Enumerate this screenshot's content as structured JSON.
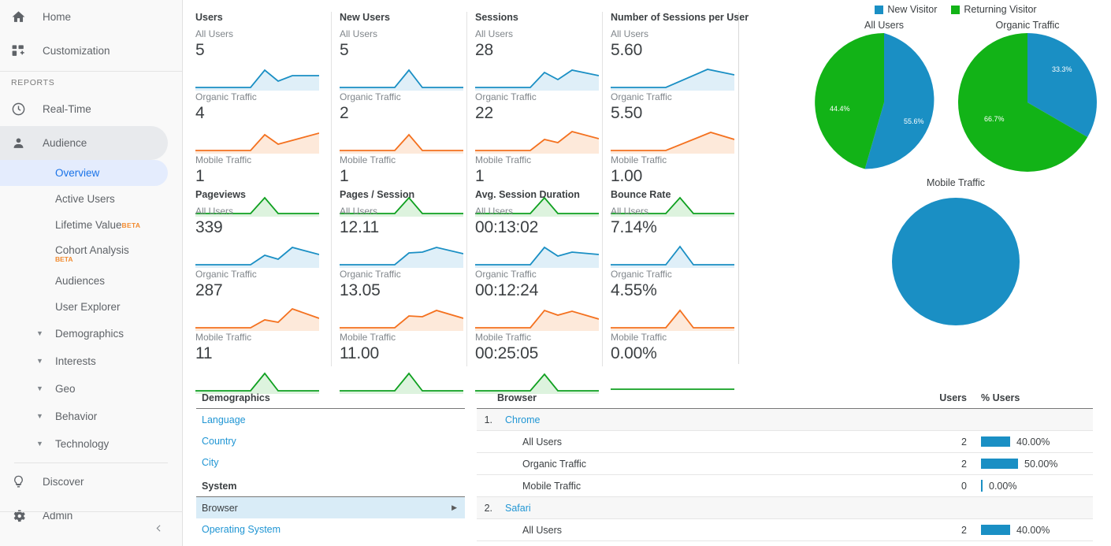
{
  "sidebar": {
    "top_items": [
      {
        "label": "Home",
        "icon": "home-icon"
      },
      {
        "label": "Customization",
        "icon": "customization-icon"
      }
    ],
    "section_label": "REPORTS",
    "reports": [
      {
        "label": "Real-Time",
        "icon": "clock-icon"
      },
      {
        "label": "Audience",
        "icon": "person-icon",
        "state": "expanded"
      }
    ],
    "audience_sub": [
      {
        "label": "Overview",
        "state": "active"
      },
      {
        "label": "Active Users"
      },
      {
        "label": "Lifetime Value",
        "badge": "BETA",
        "badge_pos": "super"
      },
      {
        "label": "Cohort Analysis",
        "badge": "BETA",
        "badge_pos": "below"
      },
      {
        "label": "Audiences"
      },
      {
        "label": "User Explorer"
      },
      {
        "label": "Demographics",
        "caret": "▼"
      },
      {
        "label": "Interests",
        "caret": "▼"
      },
      {
        "label": "Geo",
        "caret": "▼"
      },
      {
        "label": "Behavior",
        "caret": "▼"
      },
      {
        "label": "Technology",
        "caret": "▼"
      }
    ],
    "bottom_items": [
      {
        "label": "Discover",
        "icon": "lightbulb-icon"
      },
      {
        "label": "Admin",
        "icon": "gear-icon"
      }
    ],
    "collapse_icon": "chevron-left-icon"
  },
  "segments": [
    "All Users",
    "Organic Traffic",
    "Mobile Traffic"
  ],
  "cards": [
    {
      "title": "Users",
      "values": [
        "5",
        "4",
        "1"
      ]
    },
    {
      "title": "New Users",
      "values": [
        "5",
        "2",
        "1"
      ]
    },
    {
      "title": "Sessions",
      "values": [
        "28",
        "22",
        "1"
      ]
    },
    {
      "title": "Number of Sessions per User",
      "values": [
        "5.60",
        "5.50",
        "1.00"
      ]
    },
    {
      "title": "Pageviews",
      "values": [
        "339",
        "287",
        "11"
      ]
    },
    {
      "title": "Pages / Session",
      "values": [
        "12.11",
        "13.05",
        "11.00"
      ]
    },
    {
      "title": "Avg. Session Duration",
      "values": [
        "00:13:02",
        "00:12:24",
        "00:25:05"
      ]
    },
    {
      "title": "Bounce Rate",
      "values": [
        "7.14%",
        "4.55%",
        "0.00%"
      ]
    }
  ],
  "colors": {
    "all_users": "#1a8fc4",
    "organic": "#f4711f",
    "mobile": "#0fa020",
    "new_visitor": "#1a8fc4",
    "returning_visitor": "#12b317",
    "link": "#2196d4",
    "accent": "#1a73e8"
  },
  "pies": {
    "legend": [
      {
        "label": "New Visitor",
        "color": "#1a8fc4"
      },
      {
        "label": "Returning Visitor",
        "color": "#12b317"
      }
    ],
    "charts": [
      {
        "title": "All Users",
        "new_pct": "55.6%",
        "ret_pct": "44.4%"
      },
      {
        "title": "Organic Traffic",
        "new_pct": "33.3%",
        "ret_pct": "66.7%"
      },
      {
        "title": "Mobile Traffic",
        "new_pct": "100%",
        "ret_pct": null
      }
    ]
  },
  "demographics_panel": {
    "header": "Demographics",
    "items": [
      "Language",
      "Country",
      "City"
    ],
    "system_header": "System",
    "system_items": [
      {
        "label": "Browser",
        "selected": true,
        "arrow": "▶"
      },
      {
        "label": "Operating System",
        "selected": false
      }
    ]
  },
  "browser_table": {
    "columns": [
      "Browser",
      "Users",
      "% Users"
    ],
    "rows": [
      {
        "type": "group",
        "index": "1.",
        "name": "Chrome"
      },
      {
        "type": "seg",
        "name": "All Users",
        "users": "2",
        "pct": "40.00%",
        "bar": 37
      },
      {
        "type": "seg",
        "name": "Organic Traffic",
        "users": "2",
        "pct": "50.00%",
        "bar": 47
      },
      {
        "type": "seg",
        "name": "Mobile Traffic",
        "users": "0",
        "pct": "0.00%",
        "bar": 0
      },
      {
        "type": "group",
        "index": "2.",
        "name": "Safari"
      },
      {
        "type": "seg",
        "name": "All Users",
        "users": "2",
        "pct": "40.00%",
        "bar": 37
      }
    ]
  },
  "chart_data": [
    {
      "type": "pie",
      "title": "All Users",
      "labels": [
        "New Visitor",
        "Returning Visitor"
      ],
      "values": [
        55.6,
        44.4
      ],
      "display_labels": [
        "55.6%",
        "44.4%"
      ],
      "colors": [
        "#1a8fc4",
        "#12b317"
      ],
      "legend": "top-center"
    },
    {
      "type": "pie",
      "title": "Organic Traffic",
      "labels": [
        "New Visitor",
        "Returning Visitor"
      ],
      "values": [
        33.3,
        66.7
      ],
      "display_labels": [
        "33.3%",
        "66.7%"
      ],
      "colors": [
        "#1a8fc4",
        "#12b317"
      ],
      "legend": "top-center"
    },
    {
      "type": "pie",
      "title": "Mobile Traffic",
      "labels": [
        "New Visitor"
      ],
      "values": [
        100
      ],
      "display_labels": [
        "100%"
      ],
      "colors": [
        "#1a8fc4"
      ],
      "legend": "top-center"
    },
    {
      "type": "line",
      "title": "Users sparklines",
      "xlabel": "",
      "ylabel": "",
      "grid": false,
      "series": [
        {
          "name": "Users / All Users",
          "values": [
            0,
            0,
            0,
            0,
            3,
            5,
            2,
            4,
            4
          ]
        },
        {
          "name": "Users / Organic Traffic",
          "values": [
            0,
            0,
            0,
            0,
            3,
            4,
            2,
            3,
            4
          ]
        },
        {
          "name": "Users / Mobile Traffic",
          "values": [
            0,
            0,
            0,
            0,
            0,
            1,
            0,
            0,
            0
          ]
        },
        {
          "name": "New Users / All Users",
          "values": [
            0,
            0,
            0,
            0,
            0,
            3,
            0,
            0,
            0
          ]
        },
        {
          "name": "New Users / Organic Traffic",
          "values": [
            0,
            0,
            0,
            0,
            0,
            2,
            0,
            0,
            0
          ]
        },
        {
          "name": "New Users / Mobile Traffic",
          "values": [
            0,
            0,
            0,
            0,
            0,
            1,
            0,
            0,
            0
          ]
        },
        {
          "name": "Sessions / All Users",
          "values": [
            0,
            0,
            0,
            0,
            4,
            6,
            3,
            7,
            5
          ]
        },
        {
          "name": "Sessions / Organic Traffic",
          "values": [
            0,
            0,
            0,
            0,
            3,
            5,
            4,
            7,
            5
          ]
        },
        {
          "name": "Sessions / Mobile Traffic",
          "values": [
            0,
            0,
            0,
            0,
            0,
            1,
            0,
            0,
            0
          ]
        },
        {
          "name": "Bounce Rate / Mobile Traffic",
          "values": [
            0,
            0,
            0,
            0,
            0,
            0,
            0,
            0,
            0
          ]
        }
      ]
    }
  ]
}
